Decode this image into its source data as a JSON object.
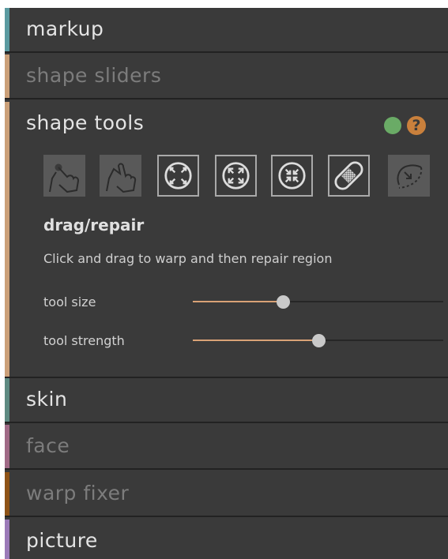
{
  "sections": {
    "markup": {
      "label": "markup",
      "stripe": "#5b9aa0",
      "state": "active"
    },
    "shape_sliders": {
      "label": "shape sliders",
      "stripe": "#cba079",
      "state": "inactive"
    },
    "shape_tools": {
      "label": "shape tools",
      "stripe": "#cba079",
      "state": "expanded"
    },
    "skin": {
      "label": "skin",
      "stripe": "#5e8a82",
      "state": "active"
    },
    "face": {
      "label": "face",
      "stripe": "#a06a86",
      "state": "inactive"
    },
    "warp_fixer": {
      "label": "warp fixer",
      "stripe": "#8e5317",
      "state": "inactive"
    },
    "picture": {
      "label": "picture",
      "stripe": "#9b7ab8",
      "state": "active"
    }
  },
  "shape_tools": {
    "status_color": "#6aab66",
    "help_label": "?",
    "help_color": "#c9803c",
    "tools": [
      {
        "icon": "drag-point-hand-icon",
        "selected": false
      },
      {
        "icon": "drag-hand-icon",
        "selected": false
      },
      {
        "icon": "expand-arrows-icon",
        "selected": true
      },
      {
        "icon": "expand-out-icon",
        "selected": true
      },
      {
        "icon": "contract-in-icon",
        "selected": true
      },
      {
        "icon": "bandage-icon",
        "selected": true
      },
      {
        "icon": "lasso-path-icon",
        "selected": false
      }
    ],
    "current_tool": "drag/repair",
    "description": "Click and drag to warp and then repair region",
    "sliders": [
      {
        "label": "tool size",
        "value": 0.36
      },
      {
        "label": "tool strength",
        "value": 0.5
      }
    ]
  }
}
